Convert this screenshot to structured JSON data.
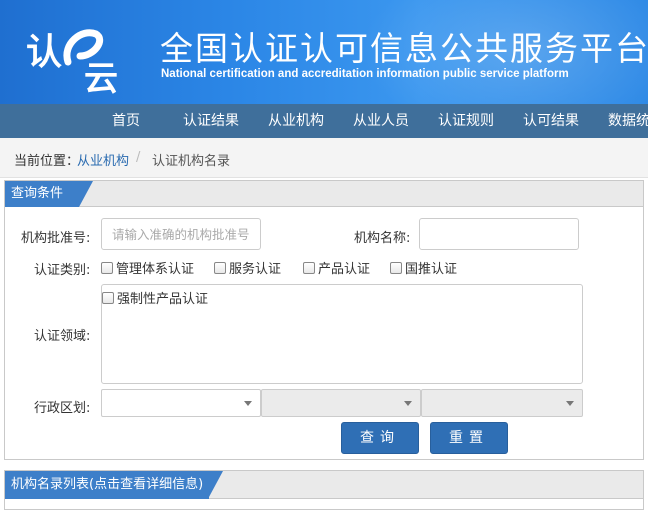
{
  "header": {
    "logo_text_1": "认",
    "logo_text_2": "云",
    "title_cn": "全国认证认可信息公共服务平台",
    "title_en": "National certification and accreditation information public service platform"
  },
  "nav": {
    "items": [
      "首页",
      "认证结果",
      "从业机构",
      "从业人员",
      "认证规则",
      "认可结果",
      "数据统"
    ]
  },
  "breadcrumb": {
    "label": "当前位置：",
    "link": "从业机构",
    "separator": "/",
    "current": "认证机构名录"
  },
  "query": {
    "title": "查询条件",
    "approval_no_label": "机构批准号:",
    "approval_no_placeholder": "请输入准确的机构批准号",
    "name_label": "机构名称:",
    "name_value": "",
    "category_label": "认证类别:",
    "categories": [
      "管理体系认证",
      "服务认证",
      "产品认证",
      "国推认证"
    ],
    "domain_label": "认证领域:",
    "domains": [
      "强制性产品认证"
    ],
    "region_label": "行政区划:",
    "search_button": "查询",
    "reset_button": "重置"
  },
  "list": {
    "title": "机构名录列表(点击查看详细信息)"
  },
  "colors": {
    "nav_bg": "#3f6f9b",
    "tab_bg": "#3d7fc9",
    "button_bg": "#2f6fb5",
    "banner": "#2b86e6"
  }
}
